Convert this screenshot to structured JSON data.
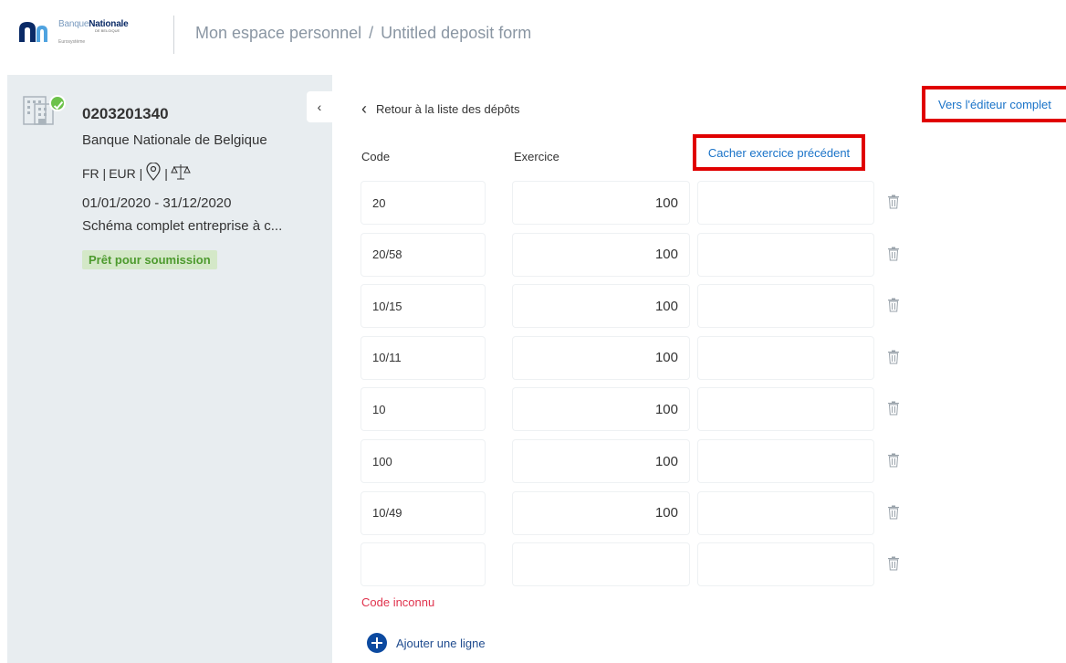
{
  "header": {
    "logo": {
      "brand_light": "Banque",
      "brand_bold": "Nationale",
      "sub": "DE BELGIQUE",
      "tagline": "Eurosystème"
    },
    "breadcrumb": {
      "root": "Mon espace personnel",
      "separator": "/",
      "current": "Untitled deposit form"
    }
  },
  "sidebar": {
    "number": "0203201340",
    "bank": "Banque Nationale de Belgique",
    "language": "FR |",
    "currency": "EUR |",
    "separator": "|",
    "dates": "01/01/2020 - 31/12/2020",
    "schema": "Schéma complet entreprise à c...",
    "status": "Prêt pour soumission",
    "collapse_icon": "chevron-left-icon",
    "status_color": "#4d9a2e"
  },
  "main": {
    "back": {
      "icon": "chevron-left-icon",
      "label": "Retour à la liste des dépôts"
    },
    "full_editor": "Vers l'éditeur complet",
    "columns": {
      "code": "Code",
      "exercise": "Exercice",
      "hide_previous": "Cacher exercice précédent"
    },
    "rows": [
      {
        "code": "20",
        "exercise": "100",
        "previous": ""
      },
      {
        "code": "20/58",
        "exercise": "100",
        "previous": ""
      },
      {
        "code": "10/15",
        "exercise": "100",
        "previous": ""
      },
      {
        "code": "10/11",
        "exercise": "100",
        "previous": ""
      },
      {
        "code": "10",
        "exercise": "100",
        "previous": ""
      },
      {
        "code": "100",
        "exercise": "100",
        "previous": ""
      },
      {
        "code": "10/49",
        "exercise": "100",
        "previous": ""
      },
      {
        "code": "",
        "exercise": "",
        "previous": ""
      }
    ],
    "error": "Code inconnu",
    "add_line": "Ajouter une ligne",
    "accent_color": "#1a73c8",
    "highlight_color": "#e00000"
  }
}
